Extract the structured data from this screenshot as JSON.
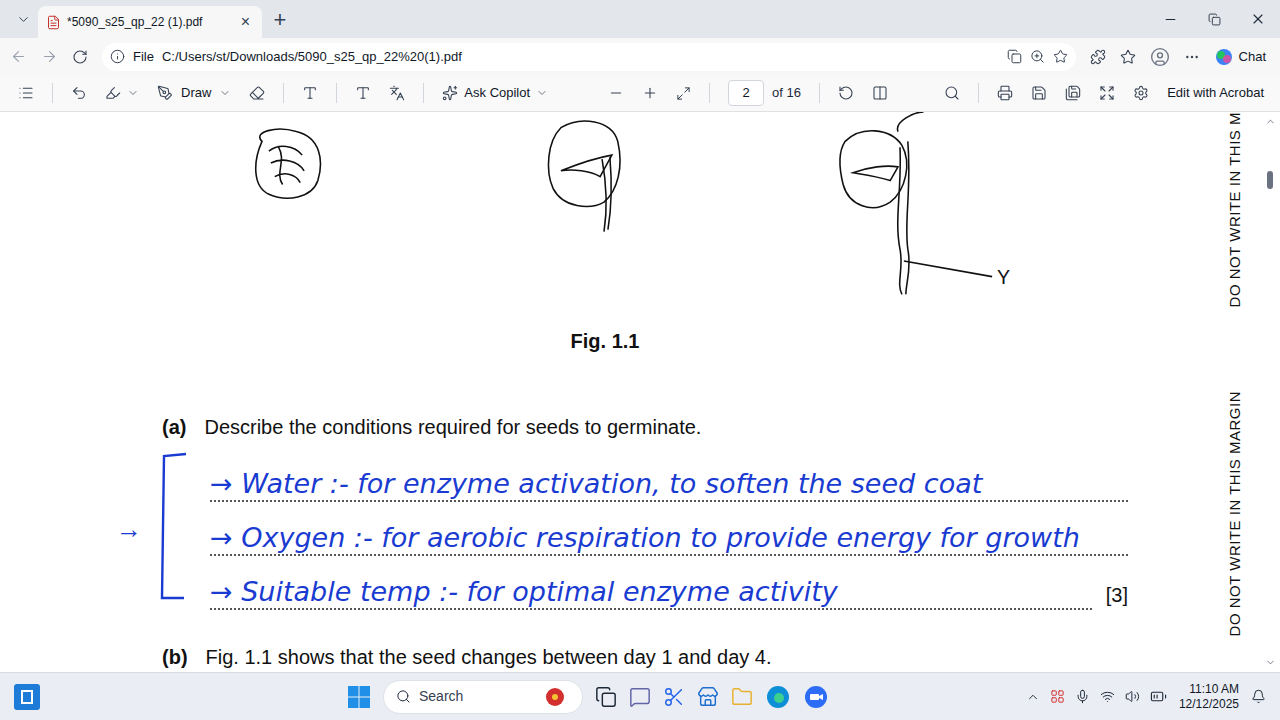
{
  "browser": {
    "tab": {
      "title": "*5090_s25_qp_22 (1).pdf",
      "close": "×"
    },
    "new_tab": "+",
    "address": {
      "scheme": "File",
      "url": "C:/Users/st/Downloads/5090_s25_qp_22%20(1).pdf"
    },
    "chat": "Chat"
  },
  "pdf_toolbar": {
    "draw": "Draw",
    "ask_copilot": "Ask Copilot",
    "page": "2",
    "page_count": "of 16",
    "edit": "Edit with Acrobat"
  },
  "document": {
    "figure": {
      "label": "Fig. 1.1",
      "pointer": "Y"
    },
    "question_a": {
      "number": "(a)",
      "text": "Describe the conditions required for seeds to germinate.",
      "marks": "[3]",
      "bracket_arrow": "→",
      "answers": [
        "→ Water :- for enzyme activation, to soften the seed coat",
        "→ Oxygen :- for aerobic respiration to provide energy for growth",
        "→ Suitable temp :- for optimal enzyme activity"
      ]
    },
    "question_b": {
      "number": "(b)",
      "text": "Fig. 1.1 shows that the seed changes between day 1 and day 4."
    },
    "margin": [
      "DO NOT WRITE IN THIS M",
      "DO NOT WRITE IN THIS MARGIN"
    ]
  },
  "taskbar": {
    "search": "Search",
    "time": "11:10 AM",
    "date": "12/12/2025"
  }
}
